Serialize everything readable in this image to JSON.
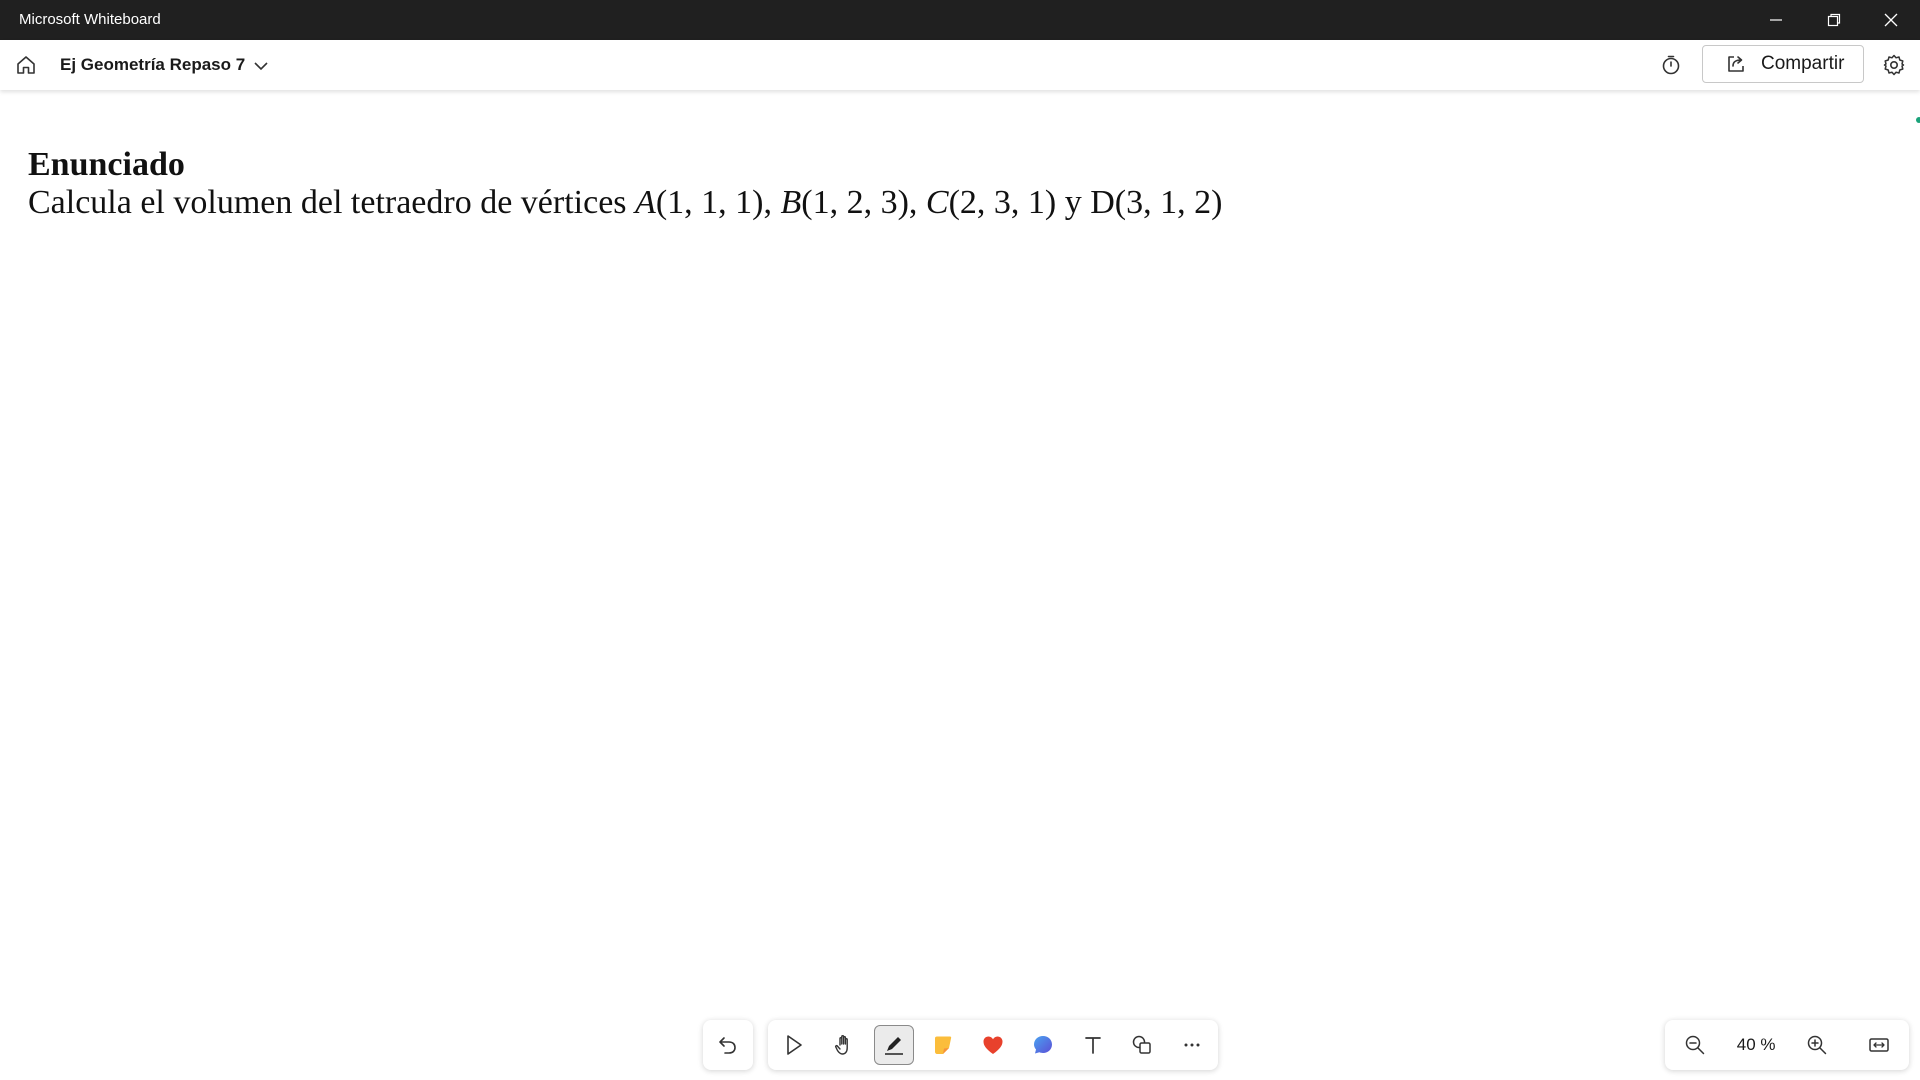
{
  "window": {
    "title": "Microsoft Whiteboard",
    "controls": [
      "minimize-icon",
      "restore-icon",
      "close-icon"
    ]
  },
  "appbar": {
    "board_title": "Ej Geometría Repaso 7",
    "share_label": "Compartir",
    "icons": [
      "home-icon",
      "chevron-down-icon",
      "timer-icon",
      "share-icon",
      "gear-icon"
    ]
  },
  "canvas": {
    "heading": "Enunciado",
    "statement": {
      "prefix": "Calcula el volumen del tetraedro de vértices ",
      "a_label": "A",
      "a_coords": "(1, 1, 1), ",
      "b_label": "B",
      "b_coords": "(1, 2, 3), ",
      "c_label": "C",
      "c_coords": "(2, 3, 1) y D(3, 1, 2)"
    }
  },
  "toolbar": {
    "tools": [
      "undo-icon",
      "select-icon",
      "hand-icon",
      "pen-icon",
      "sticky-note-icon",
      "reactions-icon",
      "comment-icon",
      "text-icon",
      "shapes-icon",
      "more-icon"
    ],
    "active_tool": "pen"
  },
  "zoom": {
    "level": "40 %",
    "icons": [
      "zoom-out-icon",
      "zoom-in-icon",
      "fit-to-screen-icon"
    ]
  }
}
